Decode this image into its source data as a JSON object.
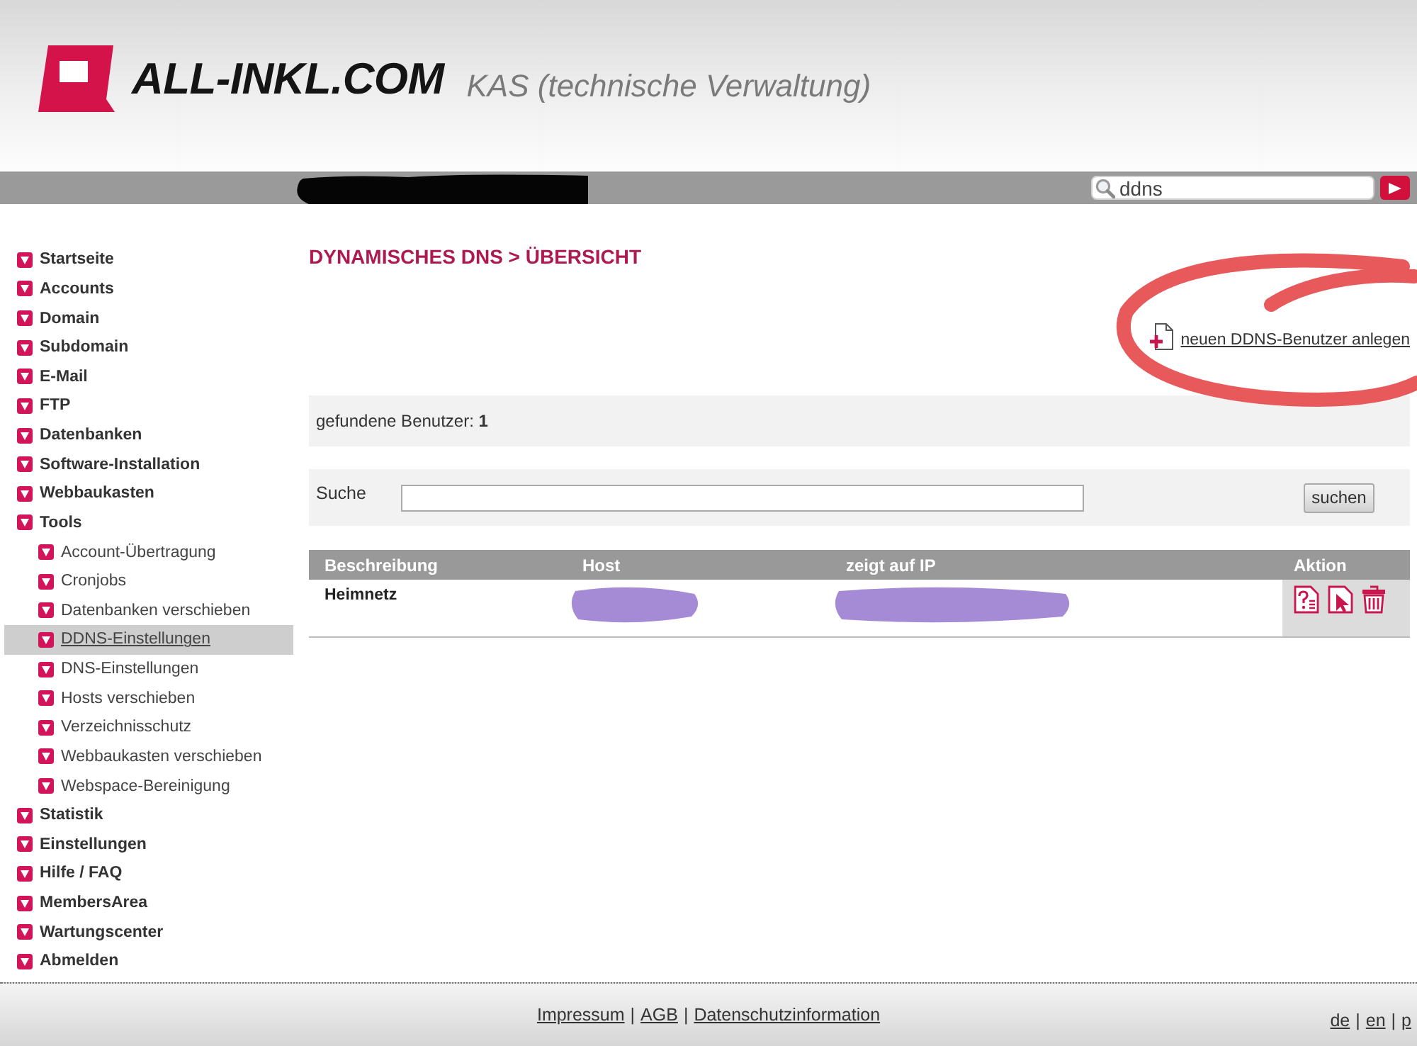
{
  "header": {
    "brand": "ALL-INKL.COM",
    "subtitle": "KAS (technische Verwaltung)"
  },
  "top_bar": {
    "redacted": true,
    "search": {
      "value": "ddns"
    }
  },
  "sidebar": {
    "items": [
      {
        "label": "Startseite",
        "selected": false
      },
      {
        "label": "Accounts",
        "selected": false
      },
      {
        "label": "Domain",
        "selected": false
      },
      {
        "label": "Subdomain",
        "selected": false
      },
      {
        "label": "E-Mail",
        "selected": false
      },
      {
        "label": "FTP",
        "selected": false
      },
      {
        "label": "Datenbanken",
        "selected": false
      },
      {
        "label": "Software-Installation",
        "selected": false
      },
      {
        "label": "Webbaukasten",
        "selected": false
      },
      {
        "label": "Tools",
        "selected": false,
        "children": [
          {
            "label": "Account-Übertragung",
            "selected": false
          },
          {
            "label": "Cronjobs",
            "selected": false
          },
          {
            "label": "Datenbanken verschieben",
            "selected": false
          },
          {
            "label": "DDNS-Einstellungen",
            "selected": true
          },
          {
            "label": "DNS-Einstellungen",
            "selected": false
          },
          {
            "label": "Hosts verschieben",
            "selected": false
          },
          {
            "label": "Verzeichnisschutz",
            "selected": false
          },
          {
            "label": "Webbaukasten verschieben",
            "selected": false
          },
          {
            "label": "Webspace-Bereinigung",
            "selected": false
          }
        ]
      },
      {
        "label": "Statistik",
        "selected": false
      },
      {
        "label": "Einstellungen",
        "selected": false
      },
      {
        "label": "Hilfe / FAQ",
        "selected": false
      },
      {
        "label": "MembersArea",
        "selected": false
      },
      {
        "label": "Wartungscenter",
        "selected": false
      },
      {
        "label": "Abmelden",
        "selected": false
      }
    ]
  },
  "main": {
    "title": "DYNAMISCHES DNS > ÜBERSICHT",
    "new_user_link": "neuen DDNS-Benutzer anlegen",
    "found": "gefundene Benutzer: **1**",
    "search": {
      "label": "Suche",
      "button": "suchen"
    },
    "table": {
      "columns": [
        "Beschreibung",
        "Host",
        "zeigt auf IP",
        "Aktion"
      ],
      "rows": [
        {
          "description": "Heimnetz",
          "host": {
            "redacted": true
          },
          "ip": {
            "redacted": true
          },
          "actions": [
            {
              "kind": "details"
            },
            {
              "kind": "edit"
            },
            {
              "kind": "delete"
            }
          ]
        }
      ]
    }
  },
  "annotation": {
    "kind": "circle"
  },
  "footer": {
    "links": [
      "Impressum",
      "AGB",
      "Datenschutzinformation"
    ],
    "separator": "|",
    "languages": [
      "de",
      "en",
      "p"
    ]
  }
}
